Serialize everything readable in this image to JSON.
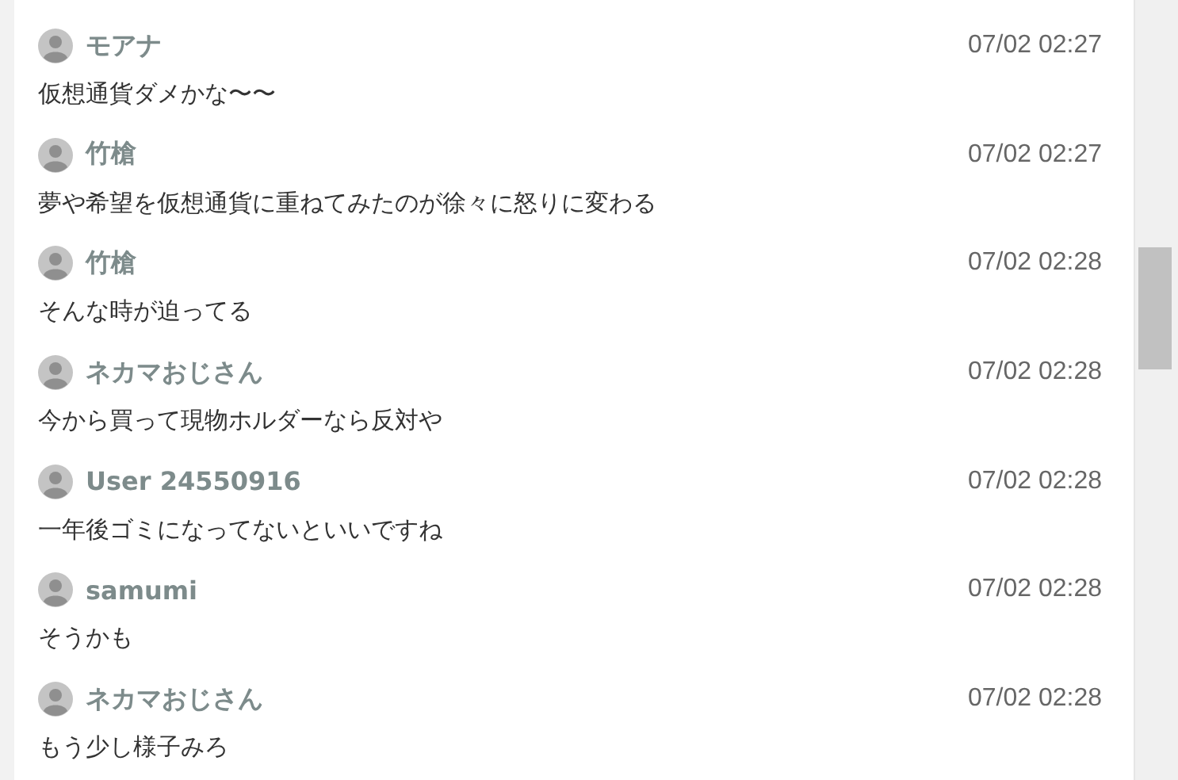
{
  "comments": [
    {
      "user": "モアナ",
      "time": "07/02 02:27",
      "text": "仮想通貨ダメかな〜〜"
    },
    {
      "user": "竹槍",
      "time": "07/02 02:27",
      "text": "夢や希望を仮想通貨に重ねてみたのが徐々に怒りに変わる"
    },
    {
      "user": "竹槍",
      "time": "07/02 02:28",
      "text": "そんな時が迫ってる"
    },
    {
      "user": "ネカマおじさん",
      "time": "07/02 02:28",
      "text": "今から買って現物ホルダーなら反対や"
    },
    {
      "user": "User 24550916",
      "time": "07/02 02:28",
      "text": "一年後ゴミになってないといいですね"
    },
    {
      "user": "samumi",
      "time": "07/02 02:28",
      "text": "そうかも"
    },
    {
      "user": "ネカマおじさん",
      "time": "07/02 02:28",
      "text": "もう少し様子みろ"
    }
  ]
}
